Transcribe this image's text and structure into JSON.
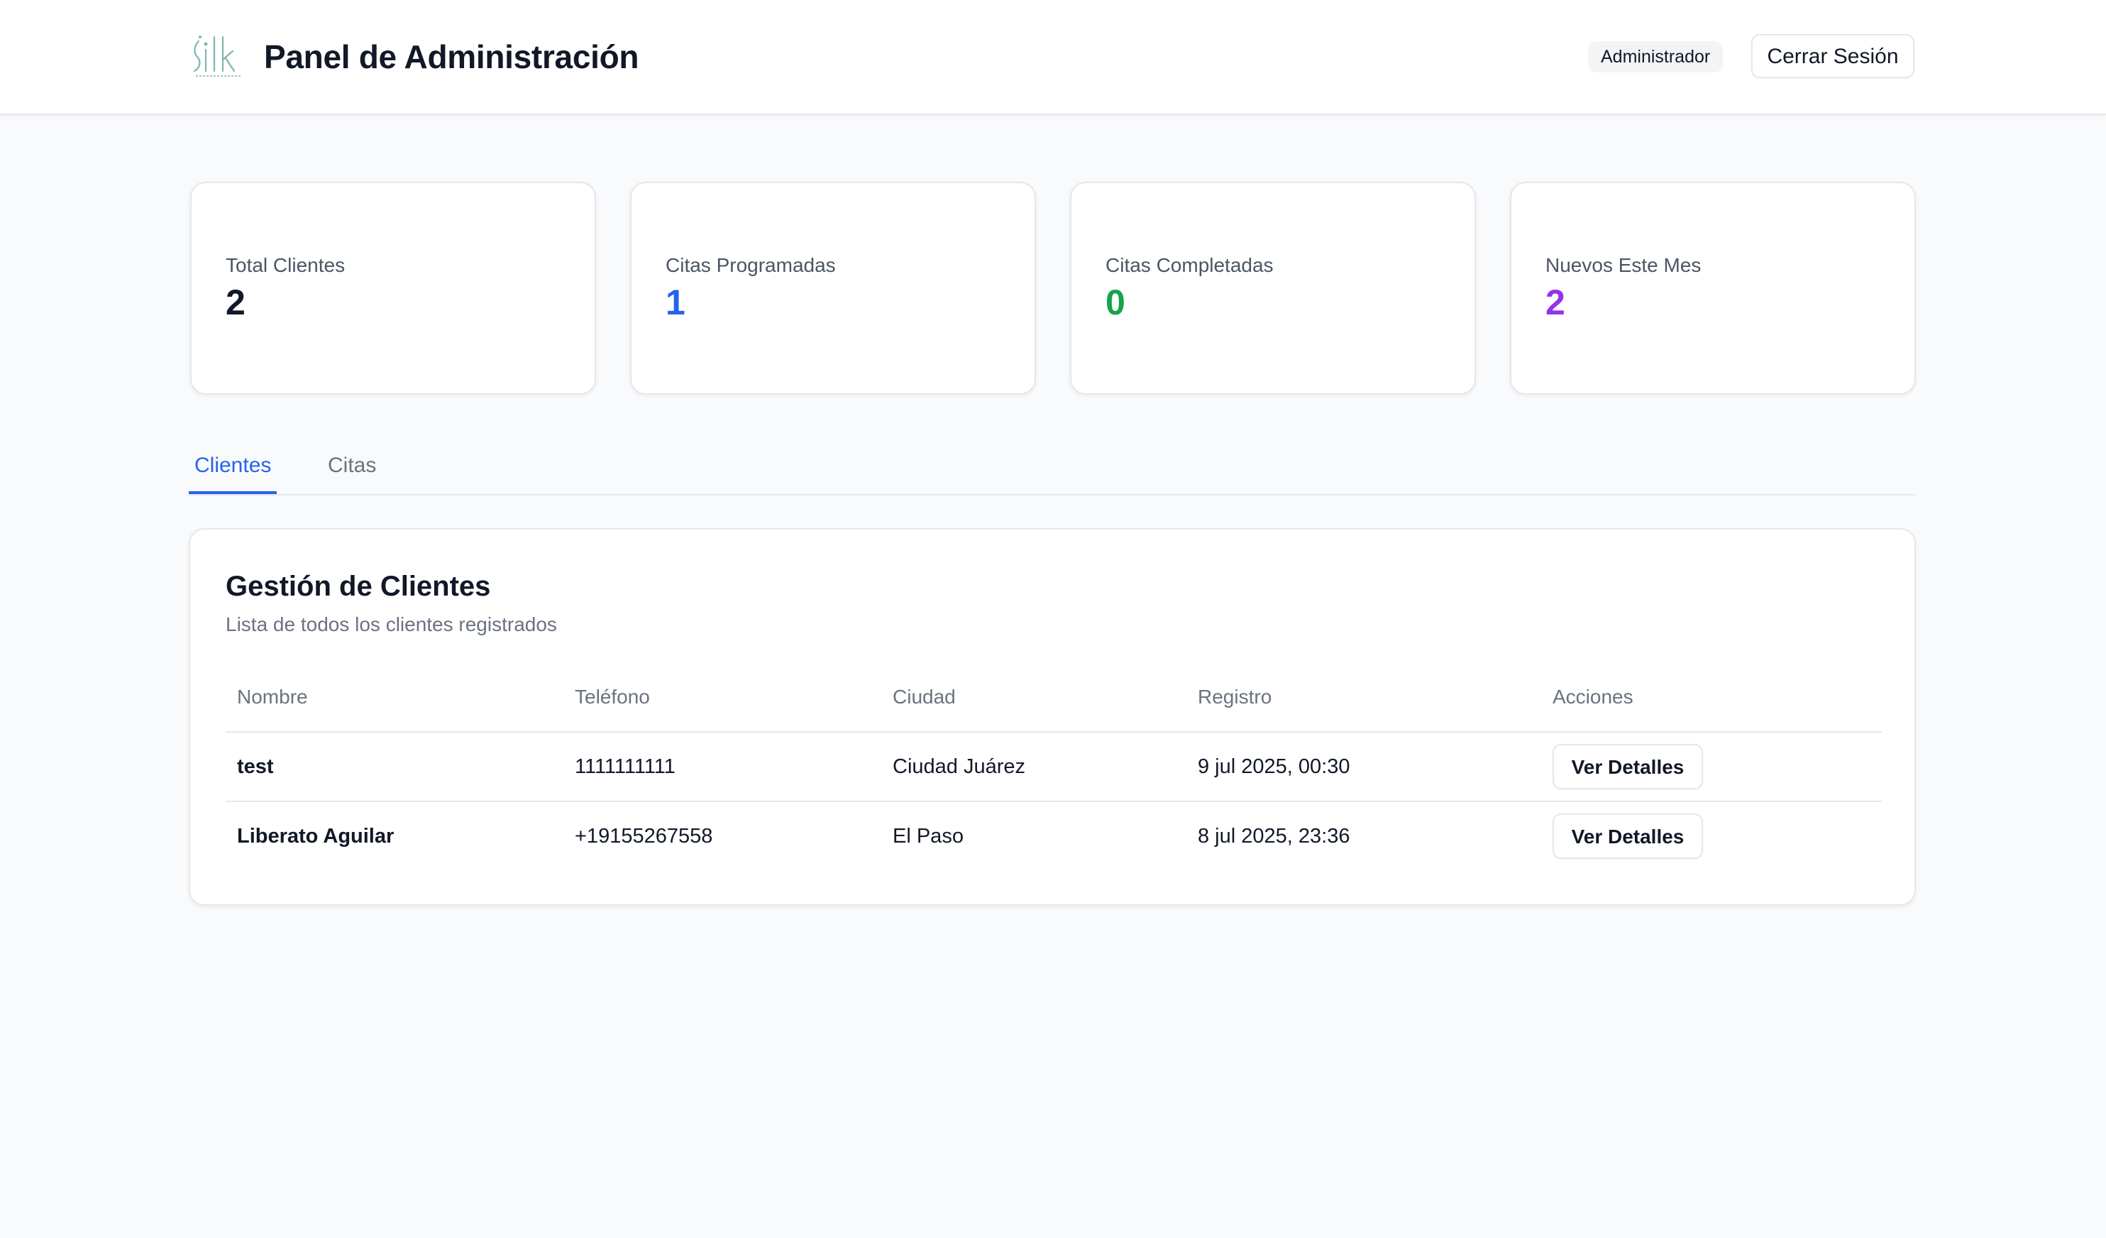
{
  "header": {
    "logo_icon": "silk-logo-icon",
    "title": "Panel de Administración",
    "role_badge": "Administrador",
    "logout_label": "Cerrar Sesión"
  },
  "stats": [
    {
      "label": "Total Clientes",
      "value": "2",
      "color": "#111827"
    },
    {
      "label": "Citas Programadas",
      "value": "1",
      "color": "#2563eb"
    },
    {
      "label": "Citas Completadas",
      "value": "0",
      "color": "#16a34a"
    },
    {
      "label": "Nuevos Este Mes",
      "value": "2",
      "color": "#9333ea"
    }
  ],
  "tabs": [
    {
      "label": "Clientes",
      "active": true
    },
    {
      "label": "Citas",
      "active": false
    }
  ],
  "clients_card": {
    "title": "Gestión de Clientes",
    "subtitle": "Lista de todos los clientes registrados",
    "columns": [
      "Nombre",
      "Teléfono",
      "Ciudad",
      "Registro",
      "Acciones"
    ],
    "rows": [
      {
        "name": "test",
        "phone": "1111111111",
        "city": "Ciudad Juárez",
        "registered": "9 jul 2025, 00:30",
        "action": "Ver Detalles"
      },
      {
        "name": "Liberato Aguilar",
        "phone": "+19155267558",
        "city": "El Paso",
        "registered": "8 jul 2025, 23:36",
        "action": "Ver Detalles"
      }
    ]
  },
  "colors": {
    "accent": "#2563eb",
    "page_bg": "#f9fafb",
    "logo": "#7fb5ad"
  }
}
